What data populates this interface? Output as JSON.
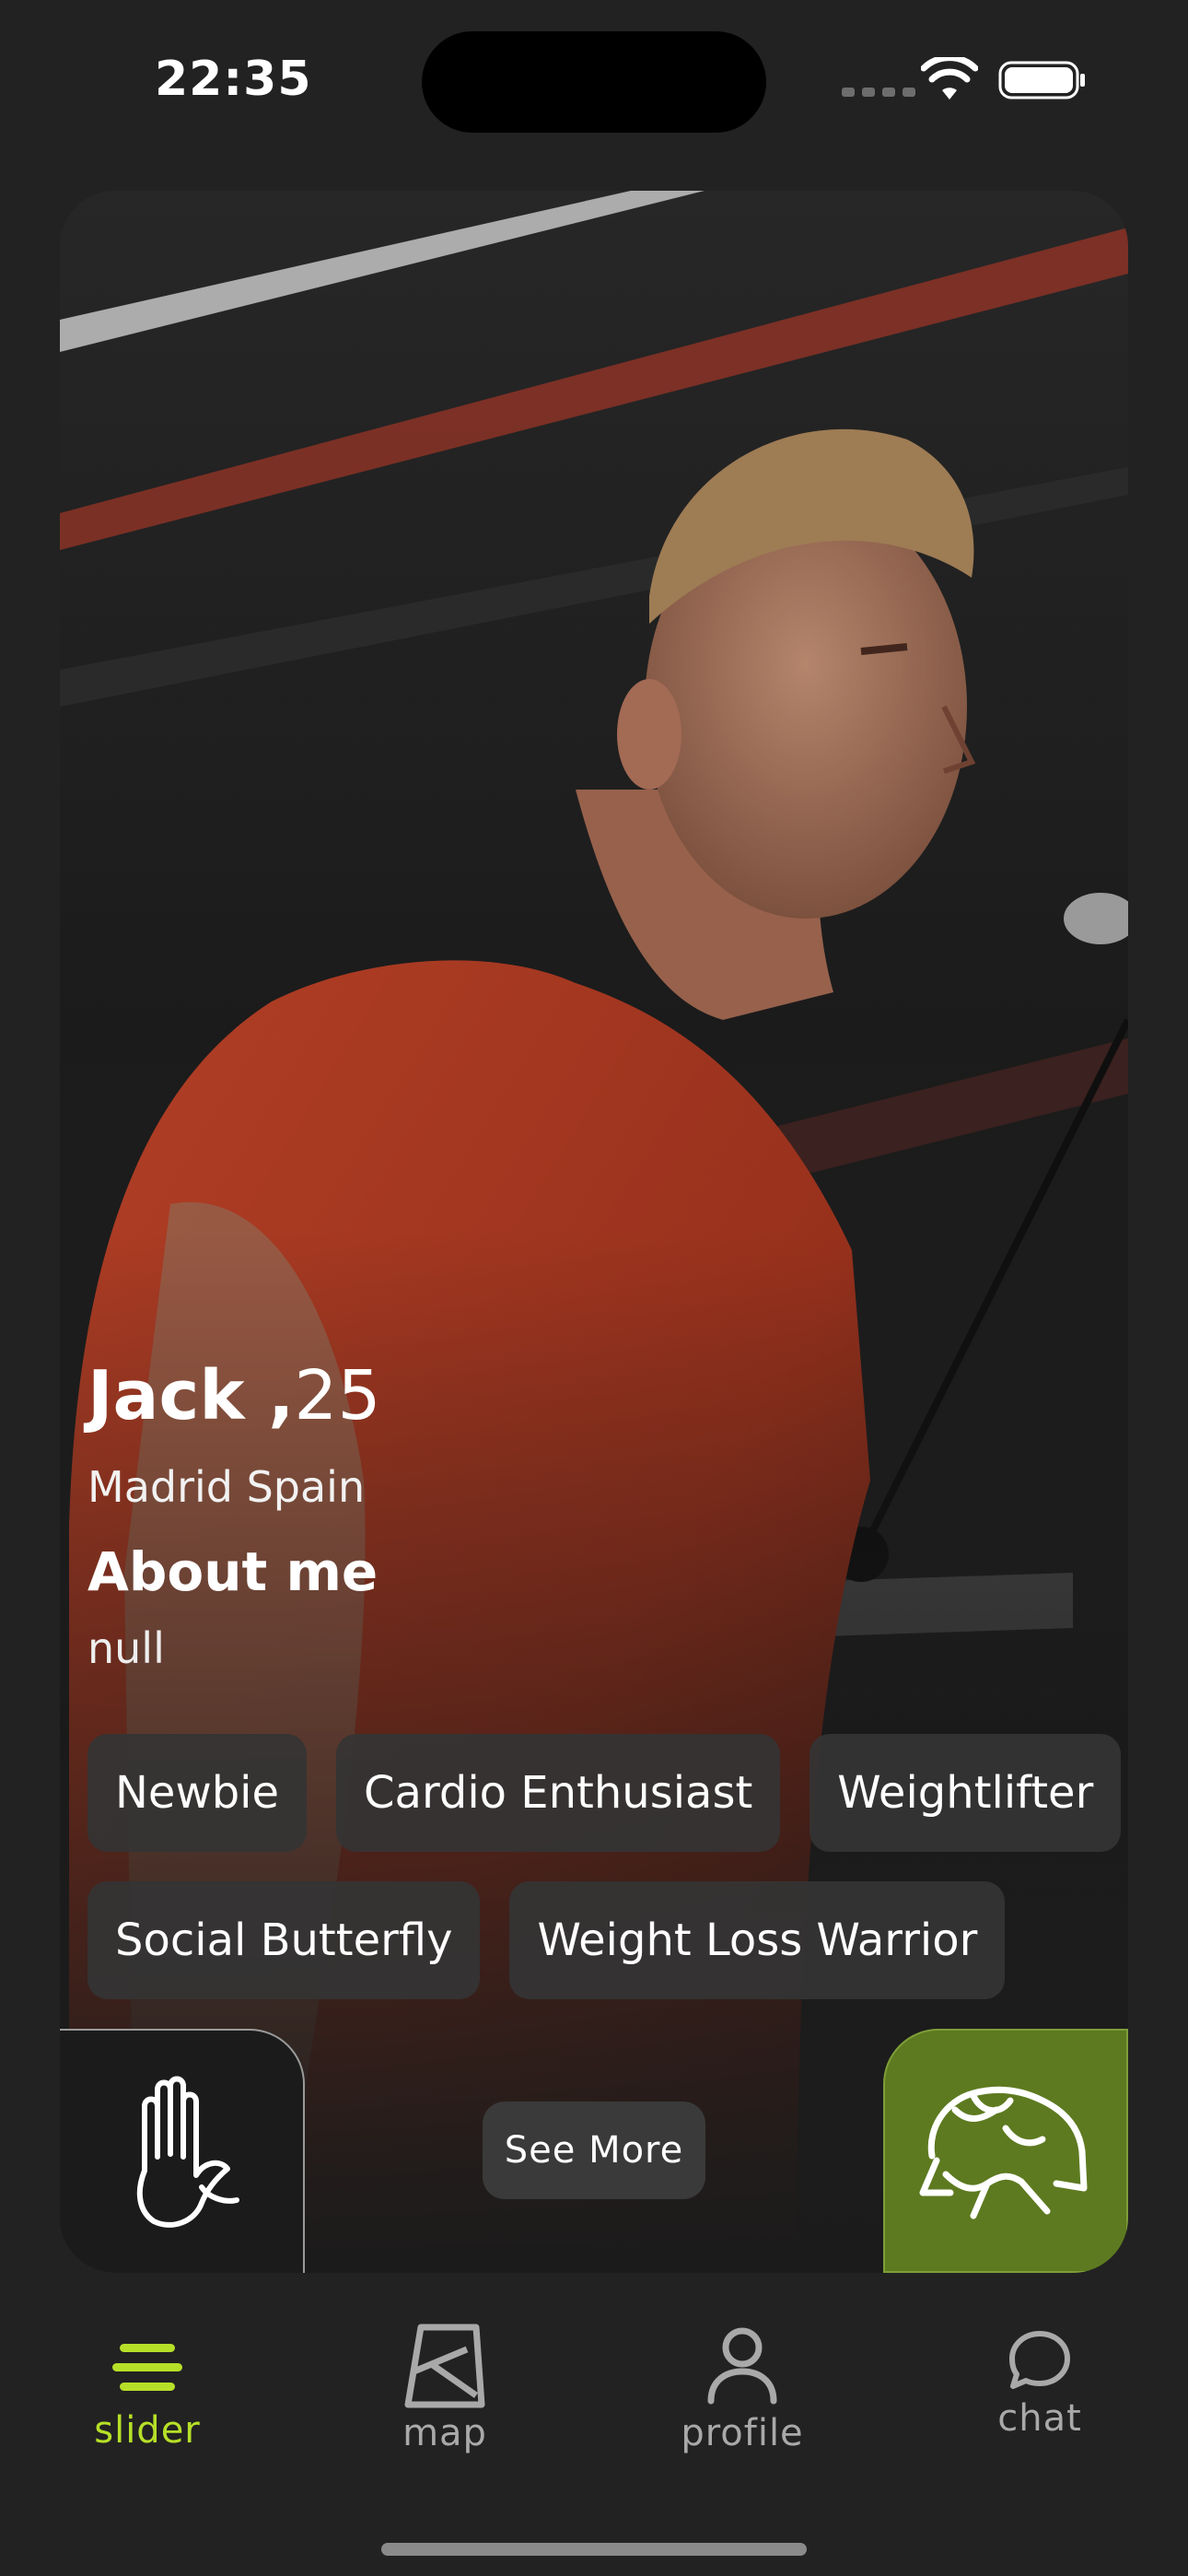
{
  "status_bar": {
    "time": "22:35"
  },
  "profile": {
    "name": "Jack",
    "separator": " ,",
    "age": "25",
    "location": "Madrid Spain",
    "about_title": "About me",
    "about_text": "null",
    "tags_row1": [
      "Newbie",
      "Cardio Enthusiast",
      "Weightlifter"
    ],
    "tags_row2": [
      "Social Butterfly",
      "Weight Loss Warrior"
    ]
  },
  "actions": {
    "pass_icon": "raised-hand-icon",
    "see_more": "See More",
    "match_icon": "handshake-icon"
  },
  "nav": {
    "items": [
      {
        "label": "slider",
        "icon": "menu-lines-icon",
        "active": true
      },
      {
        "label": "map",
        "icon": "map-icon",
        "active": false
      },
      {
        "label": "profile",
        "icon": "person-icon",
        "active": false
      },
      {
        "label": "chat",
        "icon": "chat-bubble-icon",
        "active": false
      }
    ]
  },
  "colors": {
    "background": "#222222",
    "accent": "#b6e028",
    "match_button": "#5d7a20",
    "tag": "#343434"
  }
}
